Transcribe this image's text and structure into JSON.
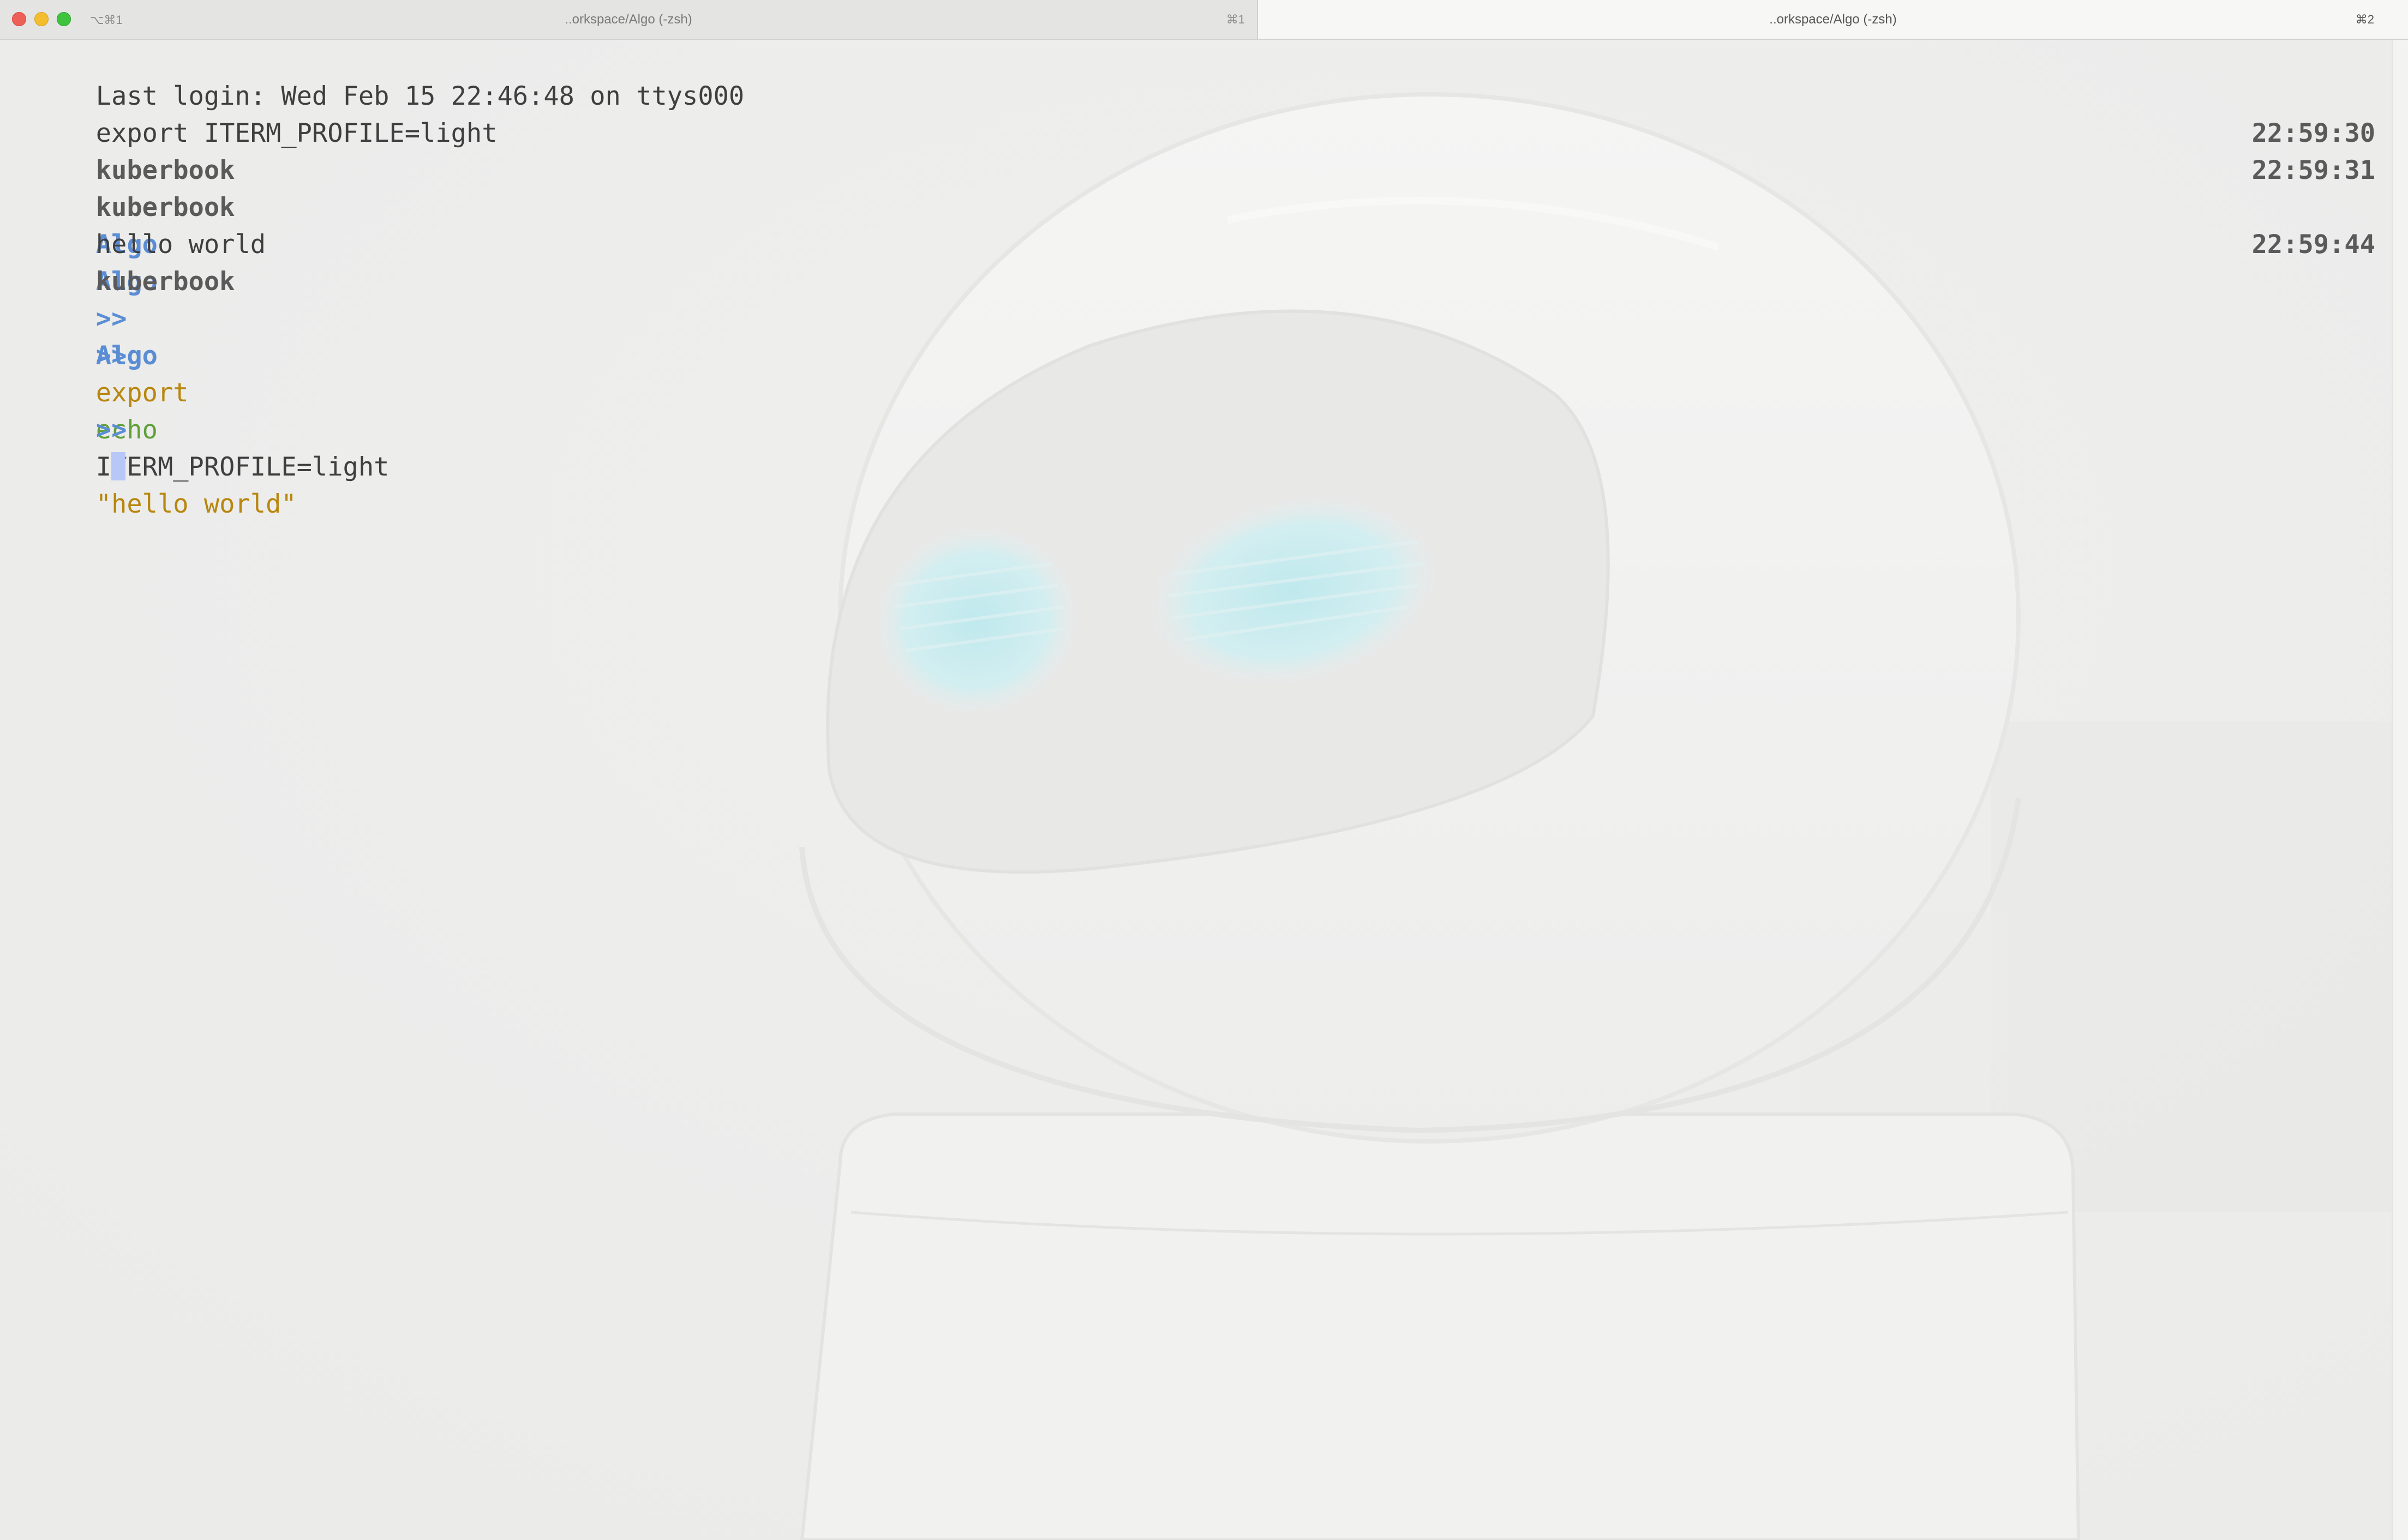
{
  "window": {
    "window_shortcut": "⌥⌘1",
    "tabs": [
      {
        "title": "..orkspace/Algo (-zsh)",
        "shortcut": "⌘1",
        "active": false
      },
      {
        "title": "..orkspace/Algo (-zsh)",
        "shortcut": "⌘2",
        "active": true
      }
    ]
  },
  "terminal": {
    "last_login": "Last login: Wed Feb 15 22:46:48 on ttys000",
    "env_line": "export ITERM_PROFILE=light",
    "prompt": {
      "host": "kuberbook",
      "dir": "Algo",
      "arrow": ">>"
    },
    "commands": [
      {
        "keyword": "export",
        "args": "ITERM_PROFILE=light",
        "time": "22:59:30"
      },
      {
        "keyword": "echo",
        "args": "\"hello world\"",
        "time": "22:59:31"
      }
    ],
    "output": "hello world",
    "current_prompt_time": "22:59:44"
  },
  "colors": {
    "prompt_dir": "#5b8dd4",
    "command_export": "#b8870e",
    "command_echo": "#5fa039",
    "string": "#b8870e",
    "cursor": "#b7c7f8"
  },
  "icons": {
    "traffic_lights": [
      "close-button-icon",
      "minimize-button-icon",
      "zoom-button-icon"
    ]
  },
  "background_image": "robot-head-wallpaper"
}
